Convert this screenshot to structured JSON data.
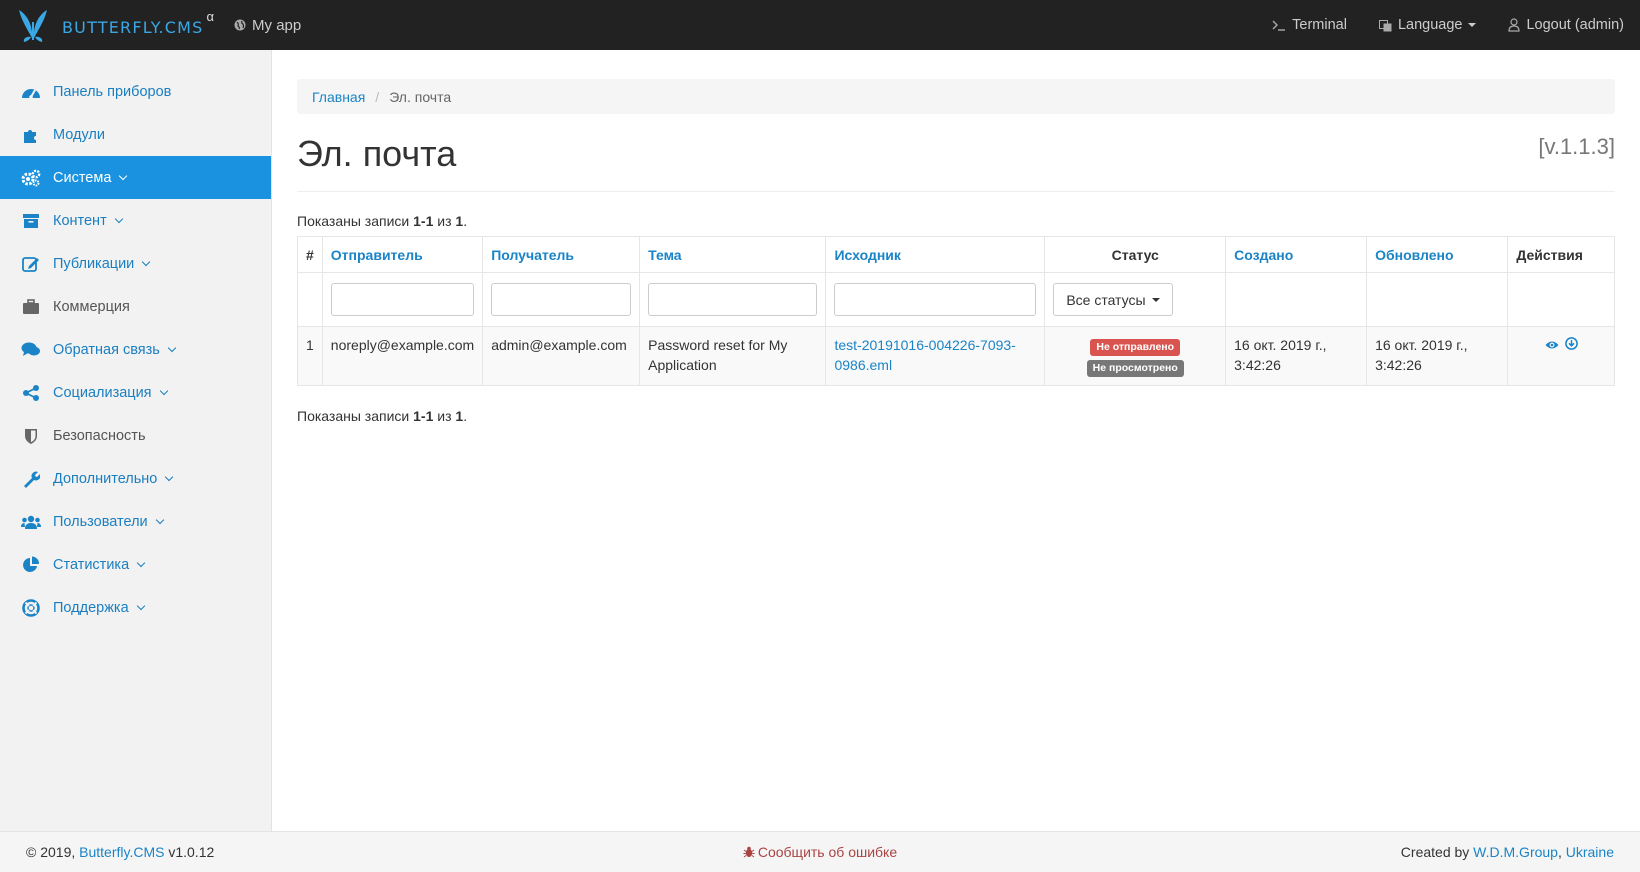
{
  "navbar": {
    "brand": "BUTTERFLY.CMS",
    "brand_sup": "α",
    "app_label": "My app",
    "terminal_label": "Terminal",
    "language_label": "Language",
    "logout_label": "Logout (admin)"
  },
  "sidebar": {
    "items": [
      {
        "label": "Панель приборов",
        "icon": "dashboard-icon"
      },
      {
        "label": "Модули",
        "icon": "puzzle-icon"
      },
      {
        "label": "Система",
        "icon": "gears-icon"
      },
      {
        "label": "Контент",
        "icon": "archive-icon"
      },
      {
        "label": "Публикации",
        "icon": "edit-icon"
      },
      {
        "label": "Коммерция",
        "icon": "briefcase-icon"
      },
      {
        "label": "Обратная связь",
        "icon": "comments-icon"
      },
      {
        "label": "Социализация",
        "icon": "share-icon"
      },
      {
        "label": "Безопасность",
        "icon": "shield-icon"
      },
      {
        "label": "Дополнительно",
        "icon": "wrench-icon"
      },
      {
        "label": "Пользователи",
        "icon": "users-icon"
      },
      {
        "label": "Статистика",
        "icon": "pie-chart-icon"
      },
      {
        "label": "Поддержка",
        "icon": "life-ring-icon"
      }
    ]
  },
  "breadcrumb": {
    "home": "Главная",
    "sep": "/",
    "current": "Эл. почта"
  },
  "page": {
    "title": "Эл. почта",
    "version": "[v.1.1.3]"
  },
  "summary": {
    "prefix": "Показаны записи ",
    "range": "1-1",
    "mid": " из ",
    "total": "1",
    "suffix": "."
  },
  "table": {
    "headers": {
      "num": "#",
      "sender": "Отправитель",
      "recipient": "Получатель",
      "subject": "Тема",
      "source": "Исходник",
      "status": "Статус",
      "created": "Создано",
      "updated": "Обновлено",
      "actions": "Действия"
    },
    "status_filter": "Все статусы",
    "rows": [
      {
        "num": "1",
        "sender": "noreply@example.com",
        "recipient": "admin@example.com",
        "subject": "Password reset for My Application",
        "source": "test-20191016-004226-7093-0986.eml",
        "status_sent": "Не отправлено",
        "status_seen": "Не просмотрено",
        "created": "16 окт. 2019 г., 3:42:26",
        "updated": "16 окт. 2019 г., 3:42:26"
      }
    ]
  },
  "footer": {
    "copyright": "© 2019, ",
    "brand_link": "Butterfly.CMS",
    "version": " v1.0.12",
    "report_bug": "Сообщить об ошибке",
    "created_by": "Created by ",
    "company": "W.D.M.Group",
    "comma": ", ",
    "country": "Ukraine"
  },
  "colors": {
    "accent": "#1a92df",
    "navbar": "#222222",
    "danger": "#d9534f",
    "link": "#1a84c7"
  }
}
